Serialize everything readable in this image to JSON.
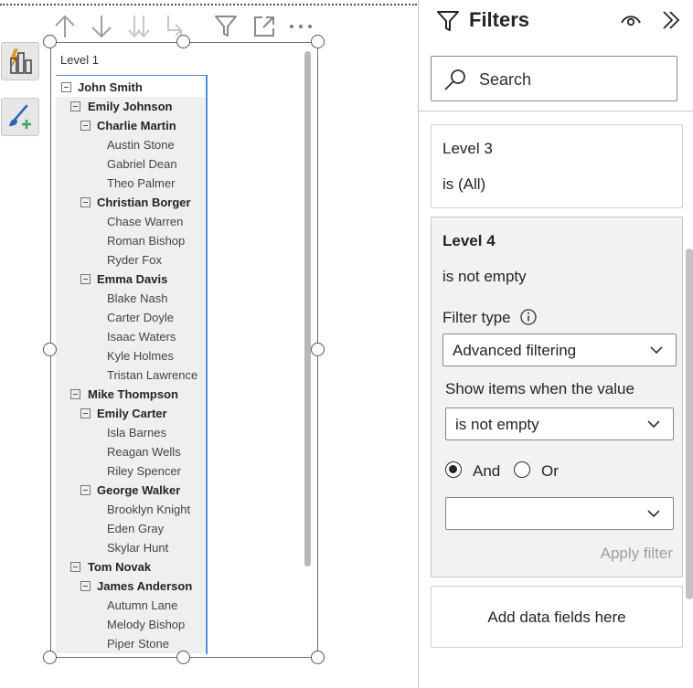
{
  "visual": {
    "column_header": "Level 1",
    "rows": [
      {
        "label": "John Smith",
        "level": 1
      },
      {
        "label": "Emily Johnson",
        "level": 2
      },
      {
        "label": "Charlie Martin",
        "level": 3
      },
      {
        "label": "Austin Stone",
        "level": 4
      },
      {
        "label": "Gabriel Dean",
        "level": 4
      },
      {
        "label": "Theo Palmer",
        "level": 4
      },
      {
        "label": "Christian Borger",
        "level": 3
      },
      {
        "label": "Chase Warren",
        "level": 4
      },
      {
        "label": "Roman Bishop",
        "level": 4
      },
      {
        "label": "Ryder Fox",
        "level": 4
      },
      {
        "label": "Emma Davis",
        "level": 3
      },
      {
        "label": "Blake Nash",
        "level": 4
      },
      {
        "label": "Carter Doyle",
        "level": 4
      },
      {
        "label": "Isaac Waters",
        "level": 4
      },
      {
        "label": "Kyle Holmes",
        "level": 4
      },
      {
        "label": "Tristan Lawrence",
        "level": 4
      },
      {
        "label": "Mike Thompson",
        "level": 2
      },
      {
        "label": "Emily Carter",
        "level": 3
      },
      {
        "label": "Isla Barnes",
        "level": 4
      },
      {
        "label": "Reagan Wells",
        "level": 4
      },
      {
        "label": "Riley Spencer",
        "level": 4
      },
      {
        "label": "George Walker",
        "level": 3
      },
      {
        "label": "Brooklyn Knight",
        "level": 4
      },
      {
        "label": "Eden Gray",
        "level": 4
      },
      {
        "label": "Skylar Hunt",
        "level": 4
      },
      {
        "label": "Tom Novak",
        "level": 2
      },
      {
        "label": "James Anderson",
        "level": 3
      },
      {
        "label": "Autumn Lane",
        "level": 4
      },
      {
        "label": "Melody Bishop",
        "level": 4
      },
      {
        "label": "Piper Stone",
        "level": 4
      }
    ]
  },
  "filters": {
    "title": "Filters",
    "search_placeholder": "Search",
    "level3": {
      "name": "Level 3",
      "state": "is (All)"
    },
    "level4": {
      "name": "Level 4",
      "state": "is not empty",
      "filter_type_label": "Filter type",
      "filter_type_value": "Advanced filtering",
      "show_items_label": "Show items when the value",
      "condition_value": "is not empty",
      "and_label": "And",
      "or_label": "Or",
      "second_condition_value": "",
      "apply_label": "Apply filter"
    },
    "add_fields_label": "Add data fields here"
  },
  "colors": {
    "accent_blue": "#4a8ad8",
    "shaded_row": "#efefef",
    "active_card_bg": "#f3f2f1",
    "disabled_text": "#a19f9d",
    "lightning": "#f2a11b",
    "brush_green": "#3aa655"
  }
}
